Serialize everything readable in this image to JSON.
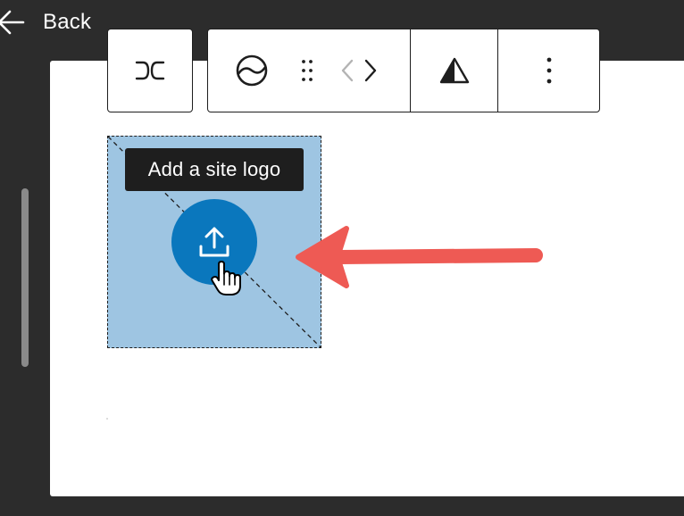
{
  "header": {
    "back_label": "Back",
    "back_icon": "arrow-left-icon"
  },
  "toolbar": {
    "transform_icon": "site-logo-block-icon",
    "style_icon": "styles-circle-icon",
    "drag_icon": "drag-handle-icon",
    "move_left_icon": "chevron-left-icon",
    "move_right_icon": "chevron-right-icon",
    "align_icon": "alignment-triangle-icon",
    "more_icon": "more-options-icon"
  },
  "site_logo": {
    "tooltip": "Add a site logo",
    "upload_icon": "upload-icon",
    "placeholder_color": "#9ec5e2",
    "button_color": "#0a77bd"
  },
  "annotation": {
    "arrow_color": "#ee5a54"
  }
}
